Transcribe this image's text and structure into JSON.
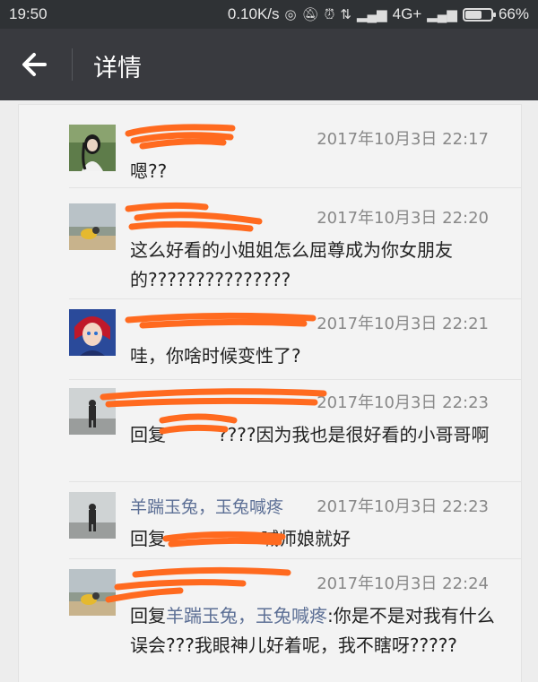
{
  "status_bar": {
    "time": "19:50",
    "net_speed": "0.10K/s",
    "network": "4G+",
    "battery": "66%",
    "battery_level": 0.66,
    "icons": [
      "nfc-icon",
      "mute-icon",
      "alarm-icon",
      "data-transfer-icon",
      "signal-icon",
      "signal-icon-2",
      "battery-icon"
    ]
  },
  "header": {
    "title": "详情",
    "back_icon": "arrow-left-icon"
  },
  "comments": [
    {
      "name": "",
      "time": "2017年10月3日 22:17",
      "text": "嗯??"
    },
    {
      "name": "",
      "time": "2017年10月3日 22:20",
      "text": "这么好看的小姐姐怎么屈尊成为你女朋友的???????????????"
    },
    {
      "name": "",
      "time": "2017年10月3日 22:21",
      "text": "哇，你啥时候变性了?"
    },
    {
      "name": "",
      "time": "2017年10月3日 22:23",
      "text_prefix": "回复",
      "text": "????因为我也是很好看的小哥哥啊"
    },
    {
      "name": "羊踹玉兔，玉兔喊疼",
      "time": "2017年10月3日 22:23",
      "text_prefix": "回复",
      "text": "喊师娘就好"
    },
    {
      "name": "",
      "time": "2017年10月3日 22:24",
      "text_prefix": "回复",
      "reply_to": "羊踹玉兔，玉兔喊疼",
      "text": ":你是不是对我有什么误会???我眼神儿好着呢，我不瞎呀?????"
    }
  ]
}
